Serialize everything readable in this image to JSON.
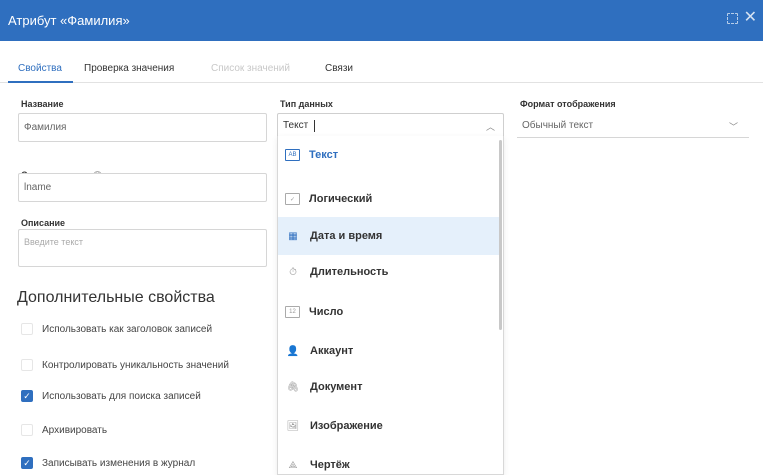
{
  "window": {
    "title": "Атрибут «Фамилия»"
  },
  "tabs": [
    {
      "label": "Свойства",
      "state": "active"
    },
    {
      "label": "Проверка значения",
      "state": "normal"
    },
    {
      "label": "Список значений",
      "state": "disabled"
    },
    {
      "label": "Связи",
      "state": "normal"
    }
  ],
  "form": {
    "name_label": "Название",
    "name_value": "Фамилия",
    "system_name_label": "Системное имя",
    "system_name_value": "lname",
    "description_label": "Описание",
    "description_placeholder": "Введите текст",
    "data_type_label": "Тип данных",
    "data_type_value": "Текст",
    "display_format_label": "Формат отображения",
    "display_format_value": "Обычный текст"
  },
  "additional": {
    "title": "Дополнительные свойства",
    "options": [
      {
        "label": "Использовать как заголовок записей",
        "checked": false
      },
      {
        "label": "Контролировать уникальность значений",
        "checked": false
      },
      {
        "label": "Использовать для поиска записей",
        "checked": true
      },
      {
        "label": "Архивировать",
        "checked": false
      },
      {
        "label": "Записывать изменения в журнал",
        "checked": true
      }
    ]
  },
  "data_types": [
    {
      "label": "Текст",
      "icon": "text-type-icon",
      "glyph": "AB",
      "state": "selected"
    },
    {
      "label": "Логический",
      "icon": "checkbox-type-icon",
      "glyph": "✓",
      "state": "normal"
    },
    {
      "label": "Дата и время",
      "icon": "calendar-icon",
      "glyph": "▦",
      "state": "highlight"
    },
    {
      "label": "Длительность",
      "icon": "stopwatch-icon",
      "glyph": "⏱",
      "state": "normal"
    },
    {
      "label": "Число",
      "icon": "number-type-icon",
      "glyph": "12",
      "state": "normal"
    },
    {
      "label": "Аккаунт",
      "icon": "user-icon",
      "glyph": "👤",
      "state": "normal"
    },
    {
      "label": "Документ",
      "icon": "paperclip-icon",
      "glyph": "🖇",
      "state": "normal"
    },
    {
      "label": "Изображение",
      "icon": "image-icon",
      "glyph": "🖼",
      "state": "normal"
    },
    {
      "label": "Чертёж",
      "icon": "drawing-icon",
      "glyph": "⟁",
      "state": "normal"
    }
  ],
  "colors": {
    "accent": "#2f6fbf",
    "highlight": "#e5f0fb"
  }
}
